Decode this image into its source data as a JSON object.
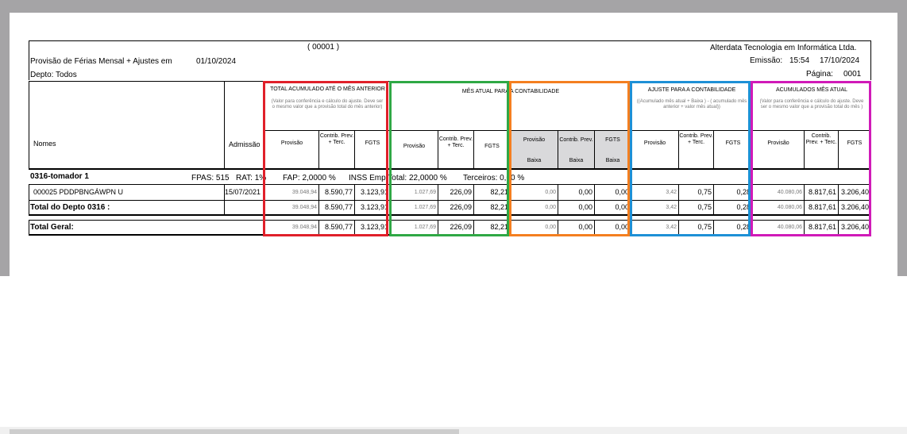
{
  "header": {
    "code": "(   00001  )",
    "company": "Alterdata Tecnologia em Informática Ltda.",
    "title": "Provisão de Férias Mensal + Ajustes em",
    "date": "01/10/2024",
    "emission_label": "Emissão:",
    "emission_time": "15:54",
    "emission_date": "17/10/2024",
    "dept_label": "Depto: Todos",
    "page_label": "Página:",
    "page_number": "0001"
  },
  "columns": {
    "nomes": "Nomes",
    "admissao": "Admissão",
    "group1": {
      "title": "TOTAL ACUMULADO ATÉ O MÊS ANTERIOR",
      "note": "(Valor para conferência e cálculo do ajuste.  Deve ser o mesmo valor que a provisão total do mês  anterior)",
      "provisao": "Provisão",
      "contrib": "Contrib. Prev. + Terc.",
      "fgts": "FGTS"
    },
    "group2": {
      "title": "MÊS ATUAL PARA A CONTABILIDADE",
      "provisao": "Provisão",
      "contrib": "Contrib. Prev. + Terc.",
      "fgts": "FGTS",
      "provisao_baixa": "Provisão",
      "contrib_baixa": "Contrib. Prev.",
      "fgts_baixa": "FGTS",
      "baixa": "Baixa"
    },
    "group3": {
      "title": "AJUSTE PARA A CONTABILIDADE",
      "note": "((Acumulado mês atual + Baixa ) - ( acumulado mês anterior + valor mês atual))",
      "provisao": "Provisão",
      "contrib": "Contrib. Prev. + Terc.",
      "fgts": "FGTS"
    },
    "group4": {
      "title": "ACUMULADOS MÊS ATUAL",
      "note": "(Valor para conferência e cálculo do ajuste.  Deve ser o mesmo valor que a provisão total do mês )",
      "provisao": "Provisão",
      "contrib": "Contrib. Prev. + Terc.",
      "fgts": "FGTS"
    }
  },
  "tomador": {
    "name": "0316-tomador 1",
    "fpas": "FPAS:  515",
    "rat": "RAT:    1%",
    "fap": "FAP:  2,0000 %",
    "inss": "INSS Emp Total:      22,0000 %",
    "terceiros": "Terceiros:    0,00 %"
  },
  "rows": [
    {
      "name": "000025  PDDPBNGÁWPN U",
      "admissao": "15/07/2021",
      "values": [
        "39.048,94",
        "8.590,77",
        "3.123,91",
        "1.027,69",
        "226,09",
        "82,21",
        "0,00",
        "0,00",
        "0,00",
        "3,42",
        "0,75",
        "0,28",
        "40.080,06",
        "8.817,61",
        "3.206,40"
      ]
    },
    {
      "name": "Total do Depto  0316  :",
      "admissao": "",
      "values": [
        "39.048,94",
        "8.590,77",
        "3.123,91",
        "1.027,69",
        "226,09",
        "82,21",
        "0,00",
        "0,00",
        "0,00",
        "3,42",
        "0,75",
        "0,28",
        "40.080,06",
        "8.817,61",
        "3.206,40"
      ]
    },
    {
      "name": "Total Geral:",
      "admissao": "",
      "values": [
        "39.048,94",
        "8.590,77",
        "3.123,91",
        "1.027,69",
        "226,09",
        "82,21",
        "0,00",
        "0,00",
        "0,00",
        "3,42",
        "0,75",
        "0,28",
        "40.080,06",
        "8.817,61",
        "3.206,40"
      ]
    }
  ],
  "highlight_colors": {
    "red": "#e0202a",
    "green": "#2fa845",
    "orange": "#f47f20",
    "blue": "#1e90d6",
    "magenta": "#d01ab8"
  }
}
